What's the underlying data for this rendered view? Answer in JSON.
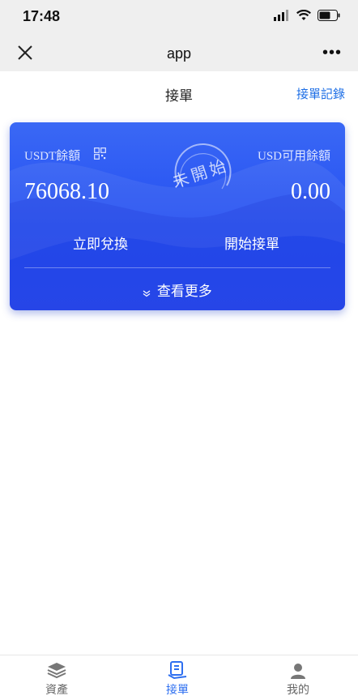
{
  "status_bar": {
    "time": "17:48"
  },
  "nav": {
    "title": "app",
    "more": "•••"
  },
  "header": {
    "title": "接單",
    "link": "接單記錄"
  },
  "card": {
    "usdt_label": "USDT餘額",
    "usd_label": "USD可用餘額",
    "usdt_value": "76068.10",
    "usd_value": "0.00",
    "stamp_text": "未開始",
    "exchange_button": "立即兌換",
    "start_button": "開始接單",
    "more_label": "查看更多",
    "more_icon": "»"
  },
  "tabbar": {
    "items": [
      {
        "label": "資產",
        "icon": "layers-icon"
      },
      {
        "label": "接單",
        "icon": "order-icon"
      },
      {
        "label": "我的",
        "icon": "person-icon"
      }
    ],
    "active_color": "#2e6ff0",
    "inactive_color": "#666666"
  },
  "colors": {
    "card_top": "#3a68f5",
    "card_bottom": "#2a4cee",
    "link": "#1e6fe6"
  }
}
